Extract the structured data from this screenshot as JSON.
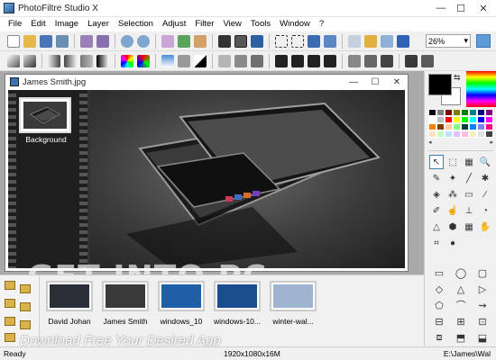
{
  "app": {
    "title": "PhotoFiltre Studio X",
    "window_buttons": {
      "minimize": "—",
      "maximize": "☐",
      "close": "✕"
    }
  },
  "menu": [
    "File",
    "Edit",
    "Image",
    "Layer",
    "Selection",
    "Adjust",
    "Filter",
    "View",
    "Tools",
    "Window",
    "?"
  ],
  "toolbar": {
    "zoom_value": "26%",
    "zoom_arrow": "▾"
  },
  "document": {
    "title": "James Smith.jpg",
    "buttons": {
      "minimize": "—",
      "maximize": "☐",
      "close": "✕"
    },
    "layer_label": "Background"
  },
  "browser": {
    "thumbnails": [
      {
        "label": "David Johan",
        "color": "#2b2f38"
      },
      {
        "label": "James Smith",
        "color": "#3a3a3a"
      },
      {
        "label": "windows_10",
        "color": "#1f5fa8"
      },
      {
        "label": "windows-10...",
        "color": "#1a4e8e"
      },
      {
        "label": "winter-wal...",
        "color": "#9fb4cf"
      }
    ]
  },
  "watermark": {
    "line1": "GET INTO PC",
    "line2": "Download Free Your Desired App"
  },
  "colors": {
    "foreground": "#000000",
    "background": "#ffffff",
    "palette": [
      "#000000",
      "#808080",
      "#800000",
      "#808000",
      "#008000",
      "#008080",
      "#000080",
      "#800080",
      "#ffffff",
      "#c0c0c0",
      "#ff0000",
      "#ffff00",
      "#00ff00",
      "#00ffff",
      "#0000ff",
      "#ff00ff",
      "#ff8000",
      "#804000",
      "#ffd0a0",
      "#80ff80",
      "#004040",
      "#0080ff",
      "#8080ff",
      "#ff0080",
      "#ffe0c0",
      "#c0ffc0",
      "#c0e0ff",
      "#e0c0ff",
      "#ffc0e0",
      "#f0f0c0",
      "#e0e0e0",
      "#404040"
    ]
  },
  "tools": [
    {
      "name": "select-arrow-icon",
      "glyph": "↖",
      "active": true
    },
    {
      "name": "lasso-select-icon",
      "glyph": "⬚",
      "active": false
    },
    {
      "name": "scroll-icon",
      "glyph": "▦",
      "active": false
    },
    {
      "name": "color-picker-icon",
      "glyph": "🔍",
      "active": false
    },
    {
      "name": "eyedropper-icon",
      "glyph": "✎",
      "active": false
    },
    {
      "name": "magic-wand-icon",
      "glyph": "✦",
      "active": false
    },
    {
      "name": "line-tool-icon",
      "glyph": "╱",
      "active": false
    },
    {
      "name": "spray-icon",
      "glyph": "✱",
      "active": false
    },
    {
      "name": "fill-bucket-icon",
      "glyph": "◈",
      "active": false
    },
    {
      "name": "spray-can-icon",
      "glyph": "⁂",
      "active": false
    },
    {
      "name": "eraser-icon",
      "glyph": "▭",
      "active": false
    },
    {
      "name": "brush-icon",
      "glyph": "∕",
      "active": false
    },
    {
      "name": "pencil-icon",
      "glyph": "✐",
      "active": false
    },
    {
      "name": "smudge-icon",
      "glyph": "☝",
      "active": false
    },
    {
      "name": "stamp-icon",
      "glyph": "⊥",
      "active": false
    },
    {
      "name": "blur-icon",
      "glyph": "◔",
      "active": false
    },
    {
      "name": "sharpen-icon",
      "glyph": "△",
      "active": false
    },
    {
      "name": "sponge-icon",
      "glyph": "⬢",
      "active": false
    },
    {
      "name": "grid-icon",
      "glyph": "▦",
      "active": false
    },
    {
      "name": "hand-icon",
      "glyph": "✋",
      "active": false
    },
    {
      "name": "crop-icon",
      "glyph": "⌗",
      "active": false
    },
    {
      "name": "fruit-icon",
      "glyph": "●",
      "active": false
    }
  ],
  "shapes": [
    {
      "name": "rectangle-shape-icon",
      "glyph": "▭"
    },
    {
      "name": "ellipse-shape-icon",
      "glyph": "◯"
    },
    {
      "name": "rounded-rect-shape-icon",
      "glyph": "▢"
    },
    {
      "name": "diamond-shape-icon",
      "glyph": "◇"
    },
    {
      "name": "triangle-shape-icon",
      "glyph": "△"
    },
    {
      "name": "right-triangle-shape-icon",
      "glyph": "▷"
    },
    {
      "name": "polygon-shape-icon",
      "glyph": "⬠"
    },
    {
      "name": "lasso-shape-icon",
      "glyph": "⌒"
    },
    {
      "name": "freeform-shape-icon",
      "glyph": "⇝"
    },
    {
      "name": "align-left-icon",
      "glyph": "⊟"
    },
    {
      "name": "align-center-icon",
      "glyph": "⊞"
    },
    {
      "name": "align-right-icon",
      "glyph": "⊡"
    },
    {
      "name": "frame-1-icon",
      "glyph": "⧈"
    },
    {
      "name": "frame-2-icon",
      "glyph": "⬒"
    },
    {
      "name": "frame-3-icon",
      "glyph": "⬓"
    }
  ],
  "status": {
    "ready": "Ready",
    "size": "1920x1080x16M",
    "path": "E:\\James\\Wal"
  }
}
